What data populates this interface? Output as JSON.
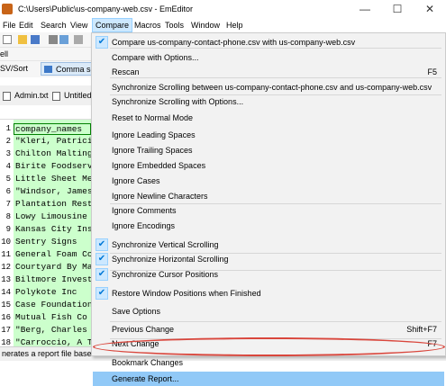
{
  "window": {
    "title": "C:\\Users\\Public\\us-company-web.csv - EmEditor",
    "minimize": "—",
    "maximize": "☐",
    "close": "✕"
  },
  "menubar": [
    "File",
    "Edit",
    "Search",
    "View",
    "Compare",
    "Macros",
    "Tools",
    "Window",
    "Help"
  ],
  "toolbar": {
    "second_row_label": "ell",
    "csv_sort_label": "SV/Sort",
    "comma_tab_label": "Comma se"
  },
  "document_tabs": [
    "Admin.txt",
    "Untitled"
  ],
  "editor": {
    "line_numbers": [
      "1",
      "2",
      "3",
      "4",
      "5",
      "6",
      "7",
      "8",
      "9",
      "10",
      "11",
      "12",
      "13",
      "14",
      "15",
      "16",
      "17",
      "18"
    ],
    "lines": [
      "company_names",
      "\"Kleri, Patricia",
      "Chilton Malting",
      "Birite Foodservi",
      "Little Sheet Met",
      "\"Windsor, James",
      "Plantation Resta",
      "Lowy Limousine S",
      "Kansas City Insu",
      "Sentry Signs",
      "General Foam Cor",
      "Courtyard By Mar",
      "Biltmore Investo",
      "Polykote Inc",
      "Case Foundation",
      "Mutual Fish Co",
      "\"Berg, Charles E",
      "\"Carroccio, A Th"
    ]
  },
  "status_bar": "nerates a report file based on t",
  "compare_menu": {
    "items": [
      {
        "label": "Compare us-company-contact-phone.csv with us-company-web.csv",
        "checked": true,
        "shortcut": ""
      },
      {
        "label": "Compare with Options...",
        "checked": false,
        "shortcut": ""
      },
      {
        "label": "Rescan",
        "checked": false,
        "shortcut": "F5"
      },
      {
        "label": "Synchronize Scrolling between us-company-contact-phone.csv and us-company-web.csv",
        "checked": false,
        "shortcut": ""
      },
      {
        "label": "Synchronize Scrolling with Options...",
        "checked": false,
        "shortcut": ""
      },
      {
        "label": "Reset to Normal Mode",
        "checked": false,
        "shortcut": ""
      },
      {
        "label": "Ignore Leading Spaces",
        "checked": false,
        "shortcut": ""
      },
      {
        "label": "Ignore Trailing Spaces",
        "checked": false,
        "shortcut": ""
      },
      {
        "label": "Ignore Embedded Spaces",
        "checked": false,
        "shortcut": ""
      },
      {
        "label": "Ignore Cases",
        "checked": false,
        "shortcut": ""
      },
      {
        "label": "Ignore Newline Characters",
        "checked": false,
        "shortcut": ""
      },
      {
        "label": "Ignore Comments",
        "checked": false,
        "shortcut": ""
      },
      {
        "label": "Ignore Encodings",
        "checked": false,
        "shortcut": ""
      },
      {
        "label": "Synchronize Vertical Scrolling",
        "checked": true,
        "shortcut": ""
      },
      {
        "label": "Synchronize Horizontal Scrolling",
        "checked": true,
        "shortcut": ""
      },
      {
        "label": "Synchronize Cursor Positions",
        "checked": true,
        "shortcut": ""
      },
      {
        "label": "Restore Window Positions when Finished",
        "checked": true,
        "shortcut": ""
      },
      {
        "label": "Save Options",
        "checked": false,
        "shortcut": ""
      },
      {
        "label": "Previous Change",
        "checked": false,
        "shortcut": "Shift+F7"
      },
      {
        "label": "Next Change",
        "checked": false,
        "shortcut": "F7"
      },
      {
        "label": "Bookmark Changes",
        "checked": false,
        "shortcut": ""
      },
      {
        "label": "Generate Report...",
        "checked": false,
        "shortcut": "",
        "selected": true
      }
    ]
  },
  "colors": {
    "editor_background": "#ccffcc",
    "menu_background": "#f2f2f2",
    "selected_item": "#91c9f7",
    "annotation": "#d9463c"
  }
}
